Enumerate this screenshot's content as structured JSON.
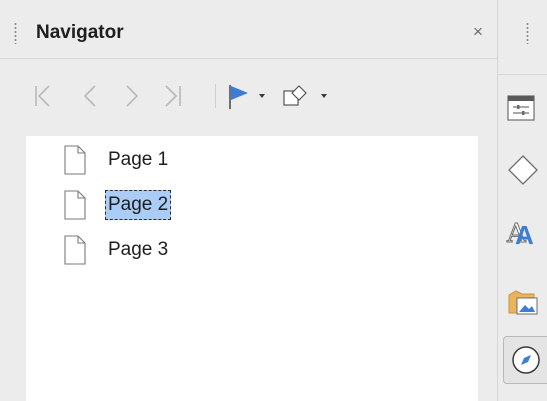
{
  "deck": {
    "title": "Navigator",
    "close_glyph": "×"
  },
  "toolbar": {
    "items": [
      {
        "name": "first-page-icon",
        "glyph": "first"
      },
      {
        "name": "previous-page-icon",
        "glyph": "previous"
      },
      {
        "name": "next-page-icon",
        "glyph": "next"
      },
      {
        "name": "last-page-icon",
        "glyph": "last"
      },
      {
        "name": "drag-mode-icon",
        "glyph": "drag-mode"
      },
      {
        "name": "shape-display-icon",
        "glyph": "shapes"
      }
    ]
  },
  "tree": {
    "pages": [
      {
        "label": "Page 1",
        "selected": false
      },
      {
        "label": "Page 2",
        "selected": true
      },
      {
        "label": "Page 3",
        "selected": false
      }
    ]
  },
  "tabbar": {
    "items": [
      {
        "name": "properties-icon"
      },
      {
        "name": "shapes-icon"
      },
      {
        "name": "styles-icon"
      },
      {
        "name": "gallery-icon"
      },
      {
        "name": "navigator-icon",
        "active": true
      }
    ]
  },
  "colors": {
    "accent": "#3c7dd8",
    "selection": "#a9cdf7",
    "panel_bg": "#ececec"
  }
}
